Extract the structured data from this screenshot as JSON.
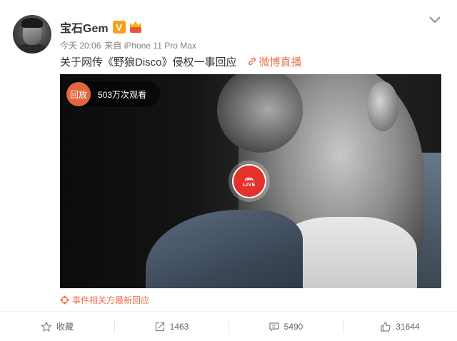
{
  "user": {
    "name": "宝石Gem",
    "verified_badge": "V",
    "timestamp": "今天 20:06",
    "source": "来自 iPhone 11 Pro Max"
  },
  "post": {
    "text": "关于网传《野狼Disco》侵权一事回应",
    "live_link": "微博直播"
  },
  "video": {
    "replay_badge": "回放",
    "view_count": "503万次观看",
    "live_label": "LIVE"
  },
  "related": {
    "label": "事件相关方最新回应"
  },
  "actions": {
    "favorite": "收藏",
    "repost_count": "1463",
    "comment_count": "5490",
    "like_count": "31644"
  },
  "colors": {
    "accent_orange": "#eb7350",
    "live_red": "#e3312b",
    "verified_gold": "#f7a11a"
  },
  "icons": [
    "chevron-down-icon",
    "link-icon",
    "star-icon",
    "repost-icon",
    "comment-icon",
    "like-icon",
    "event-icon",
    "live-camera-icon",
    "crown-icon"
  ]
}
